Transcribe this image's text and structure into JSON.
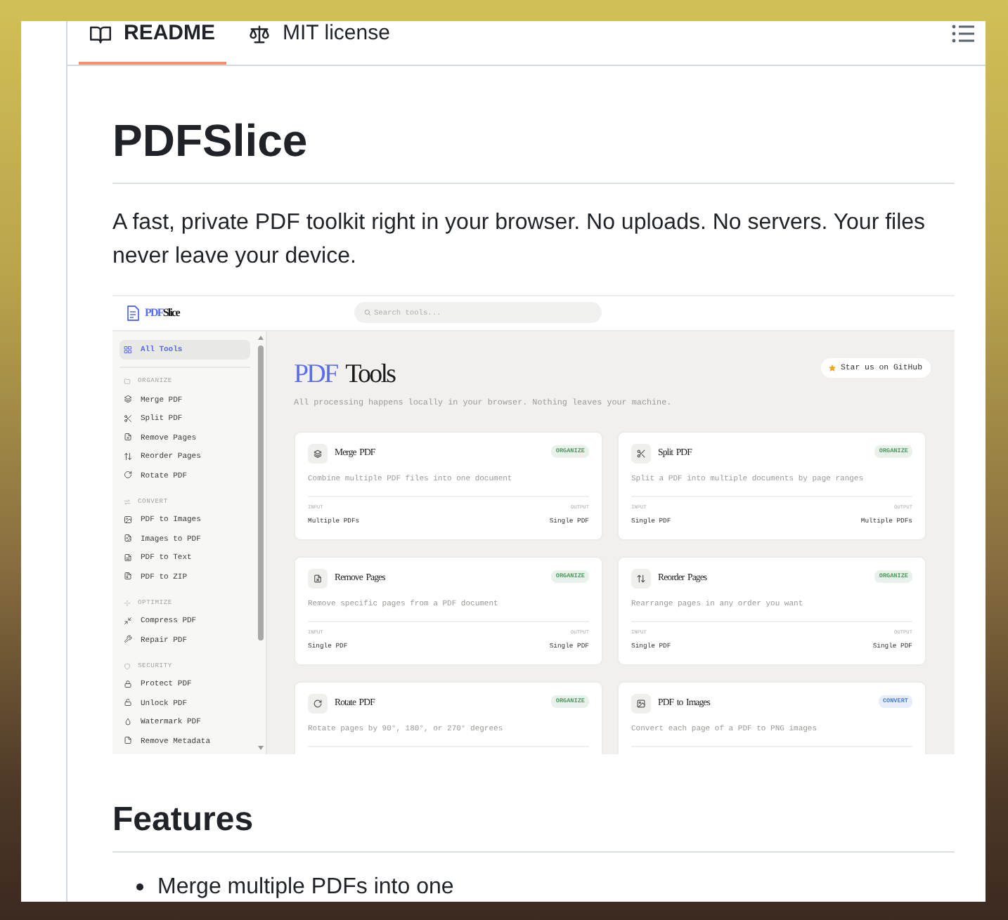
{
  "tabs": [
    {
      "label": "README",
      "selected": true
    },
    {
      "label": "MIT license",
      "selected": false
    }
  ],
  "readme": {
    "title": "PDFSlice",
    "intro": "A fast, private PDF toolkit right in your browser. No uploads. No servers. Your files never leave your device.",
    "screenshot": {
      "logo": {
        "accent": "PDF",
        "rest": "Slice"
      },
      "search": {
        "placeholder": "Search tools..."
      },
      "sidebar": {
        "items": [
          {
            "label": "All Tools",
            "selected": true
          }
        ],
        "sections": [
          {
            "title": "ORGANIZE",
            "items": [
              {
                "label": "Merge PDF",
                "selected": false
              },
              {
                "label": "Split PDF",
                "selected": false
              },
              {
                "label": "Remove Pages",
                "selected": false
              },
              {
                "label": "Reorder Pages",
                "selected": false
              },
              {
                "label": "Rotate PDF",
                "selected": false
              }
            ]
          },
          {
            "title": "CONVERT",
            "items": [
              {
                "label": "PDF to Images",
                "selected": false
              },
              {
                "label": "Images to PDF",
                "selected": false
              },
              {
                "label": "PDF to Text",
                "selected": false
              },
              {
                "label": "PDF to ZIP",
                "selected": false
              }
            ]
          },
          {
            "title": "OPTIMIZE",
            "items": [
              {
                "label": "Compress PDF",
                "selected": false
              },
              {
                "label": "Repair PDF",
                "selected": false
              }
            ]
          },
          {
            "title": "SECURITY",
            "items": [
              {
                "label": "Protect PDF",
                "selected": false
              },
              {
                "label": "Unlock PDF",
                "selected": false
              },
              {
                "label": "Watermark PDF",
                "selected": false
              },
              {
                "label": "Remove Metadata",
                "selected": false
              }
            ]
          }
        ]
      },
      "title": {
        "accent": "PDF",
        "rest": "Tools"
      },
      "subtitle": "All processing happens locally in your browser. Nothing leaves your machine.",
      "star_button": "Star us on GitHub",
      "cards": [
        {
          "title": "Merge PDF",
          "category": {
            "label": "ORGANIZE",
            "color": "#4f9a61"
          },
          "description": "Combine multiple PDF files into one document",
          "io": [
            {
              "label": "INPUT",
              "value": "Multiple PDFs"
            },
            {
              "label": "OUTPUT",
              "value": "Single PDF"
            }
          ]
        },
        {
          "title": "Split PDF",
          "category": {
            "label": "ORGANIZE",
            "color": "#4f9a61"
          },
          "description": "Split a PDF into multiple documents by page ranges",
          "io": [
            {
              "label": "INPUT",
              "value": "Single PDF"
            },
            {
              "label": "OUTPUT",
              "value": "Multiple PDFs"
            }
          ]
        },
        {
          "title": "Remove Pages",
          "category": {
            "label": "ORGANIZE",
            "color": "#4f9a61"
          },
          "description": "Remove specific pages from a PDF document",
          "io": [
            {
              "label": "INPUT",
              "value": "Single PDF"
            },
            {
              "label": "OUTPUT",
              "value": "Single PDF"
            }
          ]
        },
        {
          "title": "Reorder Pages",
          "category": {
            "label": "ORGANIZE",
            "color": "#4f9a61"
          },
          "description": "Rearrange pages in any order you want",
          "io": [
            {
              "label": "INPUT",
              "value": "Single PDF"
            },
            {
              "label": "OUTPUT",
              "value": "Single PDF"
            }
          ]
        },
        {
          "title": "Rotate PDF",
          "category": {
            "label": "ORGANIZE",
            "color": "#4f9a61"
          },
          "description": "Rotate pages by 90°, 180°, or 270° degrees"
        },
        {
          "title": "PDF to Images",
          "category": {
            "label": "CONVERT",
            "color": "#4a7fd0"
          },
          "description": "Convert each page of a PDF to PNG images"
        }
      ]
    },
    "features": {
      "heading": "Features",
      "bullets": [
        "Merge multiple PDFs into one"
      ]
    }
  }
}
